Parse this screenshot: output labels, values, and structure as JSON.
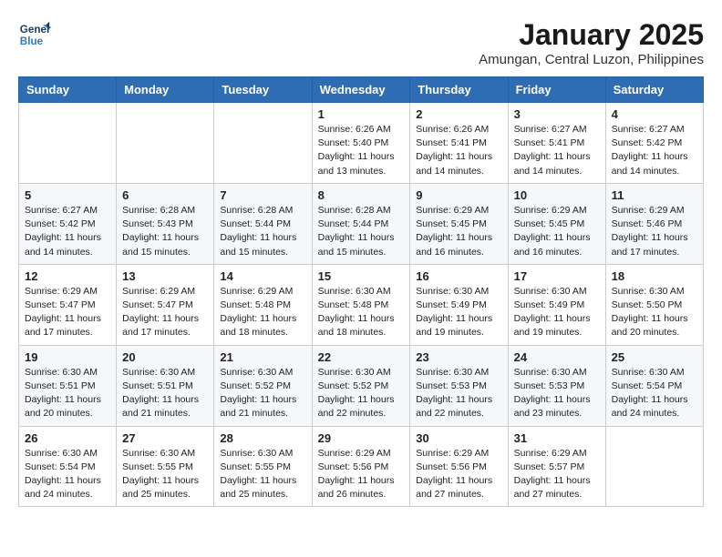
{
  "header": {
    "logo_line1": "General",
    "logo_line2": "Blue",
    "month_year": "January 2025",
    "location": "Amungan, Central Luzon, Philippines"
  },
  "weekdays": [
    "Sunday",
    "Monday",
    "Tuesday",
    "Wednesday",
    "Thursday",
    "Friday",
    "Saturday"
  ],
  "weeks": [
    [
      {
        "day": "",
        "info": ""
      },
      {
        "day": "",
        "info": ""
      },
      {
        "day": "",
        "info": ""
      },
      {
        "day": "1",
        "info": "Sunrise: 6:26 AM\nSunset: 5:40 PM\nDaylight: 11 hours and 13 minutes."
      },
      {
        "day": "2",
        "info": "Sunrise: 6:26 AM\nSunset: 5:41 PM\nDaylight: 11 hours and 14 minutes."
      },
      {
        "day": "3",
        "info": "Sunrise: 6:27 AM\nSunset: 5:41 PM\nDaylight: 11 hours and 14 minutes."
      },
      {
        "day": "4",
        "info": "Sunrise: 6:27 AM\nSunset: 5:42 PM\nDaylight: 11 hours and 14 minutes."
      }
    ],
    [
      {
        "day": "5",
        "info": "Sunrise: 6:27 AM\nSunset: 5:42 PM\nDaylight: 11 hours and 14 minutes."
      },
      {
        "day": "6",
        "info": "Sunrise: 6:28 AM\nSunset: 5:43 PM\nDaylight: 11 hours and 15 minutes."
      },
      {
        "day": "7",
        "info": "Sunrise: 6:28 AM\nSunset: 5:44 PM\nDaylight: 11 hours and 15 minutes."
      },
      {
        "day": "8",
        "info": "Sunrise: 6:28 AM\nSunset: 5:44 PM\nDaylight: 11 hours and 15 minutes."
      },
      {
        "day": "9",
        "info": "Sunrise: 6:29 AM\nSunset: 5:45 PM\nDaylight: 11 hours and 16 minutes."
      },
      {
        "day": "10",
        "info": "Sunrise: 6:29 AM\nSunset: 5:45 PM\nDaylight: 11 hours and 16 minutes."
      },
      {
        "day": "11",
        "info": "Sunrise: 6:29 AM\nSunset: 5:46 PM\nDaylight: 11 hours and 17 minutes."
      }
    ],
    [
      {
        "day": "12",
        "info": "Sunrise: 6:29 AM\nSunset: 5:47 PM\nDaylight: 11 hours and 17 minutes."
      },
      {
        "day": "13",
        "info": "Sunrise: 6:29 AM\nSunset: 5:47 PM\nDaylight: 11 hours and 17 minutes."
      },
      {
        "day": "14",
        "info": "Sunrise: 6:29 AM\nSunset: 5:48 PM\nDaylight: 11 hours and 18 minutes."
      },
      {
        "day": "15",
        "info": "Sunrise: 6:30 AM\nSunset: 5:48 PM\nDaylight: 11 hours and 18 minutes."
      },
      {
        "day": "16",
        "info": "Sunrise: 6:30 AM\nSunset: 5:49 PM\nDaylight: 11 hours and 19 minutes."
      },
      {
        "day": "17",
        "info": "Sunrise: 6:30 AM\nSunset: 5:49 PM\nDaylight: 11 hours and 19 minutes."
      },
      {
        "day": "18",
        "info": "Sunrise: 6:30 AM\nSunset: 5:50 PM\nDaylight: 11 hours and 20 minutes."
      }
    ],
    [
      {
        "day": "19",
        "info": "Sunrise: 6:30 AM\nSunset: 5:51 PM\nDaylight: 11 hours and 20 minutes."
      },
      {
        "day": "20",
        "info": "Sunrise: 6:30 AM\nSunset: 5:51 PM\nDaylight: 11 hours and 21 minutes."
      },
      {
        "day": "21",
        "info": "Sunrise: 6:30 AM\nSunset: 5:52 PM\nDaylight: 11 hours and 21 minutes."
      },
      {
        "day": "22",
        "info": "Sunrise: 6:30 AM\nSunset: 5:52 PM\nDaylight: 11 hours and 22 minutes."
      },
      {
        "day": "23",
        "info": "Sunrise: 6:30 AM\nSunset: 5:53 PM\nDaylight: 11 hours and 22 minutes."
      },
      {
        "day": "24",
        "info": "Sunrise: 6:30 AM\nSunset: 5:53 PM\nDaylight: 11 hours and 23 minutes."
      },
      {
        "day": "25",
        "info": "Sunrise: 6:30 AM\nSunset: 5:54 PM\nDaylight: 11 hours and 24 minutes."
      }
    ],
    [
      {
        "day": "26",
        "info": "Sunrise: 6:30 AM\nSunset: 5:54 PM\nDaylight: 11 hours and 24 minutes."
      },
      {
        "day": "27",
        "info": "Sunrise: 6:30 AM\nSunset: 5:55 PM\nDaylight: 11 hours and 25 minutes."
      },
      {
        "day": "28",
        "info": "Sunrise: 6:30 AM\nSunset: 5:55 PM\nDaylight: 11 hours and 25 minutes."
      },
      {
        "day": "29",
        "info": "Sunrise: 6:29 AM\nSunset: 5:56 PM\nDaylight: 11 hours and 26 minutes."
      },
      {
        "day": "30",
        "info": "Sunrise: 6:29 AM\nSunset: 5:56 PM\nDaylight: 11 hours and 27 minutes."
      },
      {
        "day": "31",
        "info": "Sunrise: 6:29 AM\nSunset: 5:57 PM\nDaylight: 11 hours and 27 minutes."
      },
      {
        "day": "",
        "info": ""
      }
    ]
  ]
}
